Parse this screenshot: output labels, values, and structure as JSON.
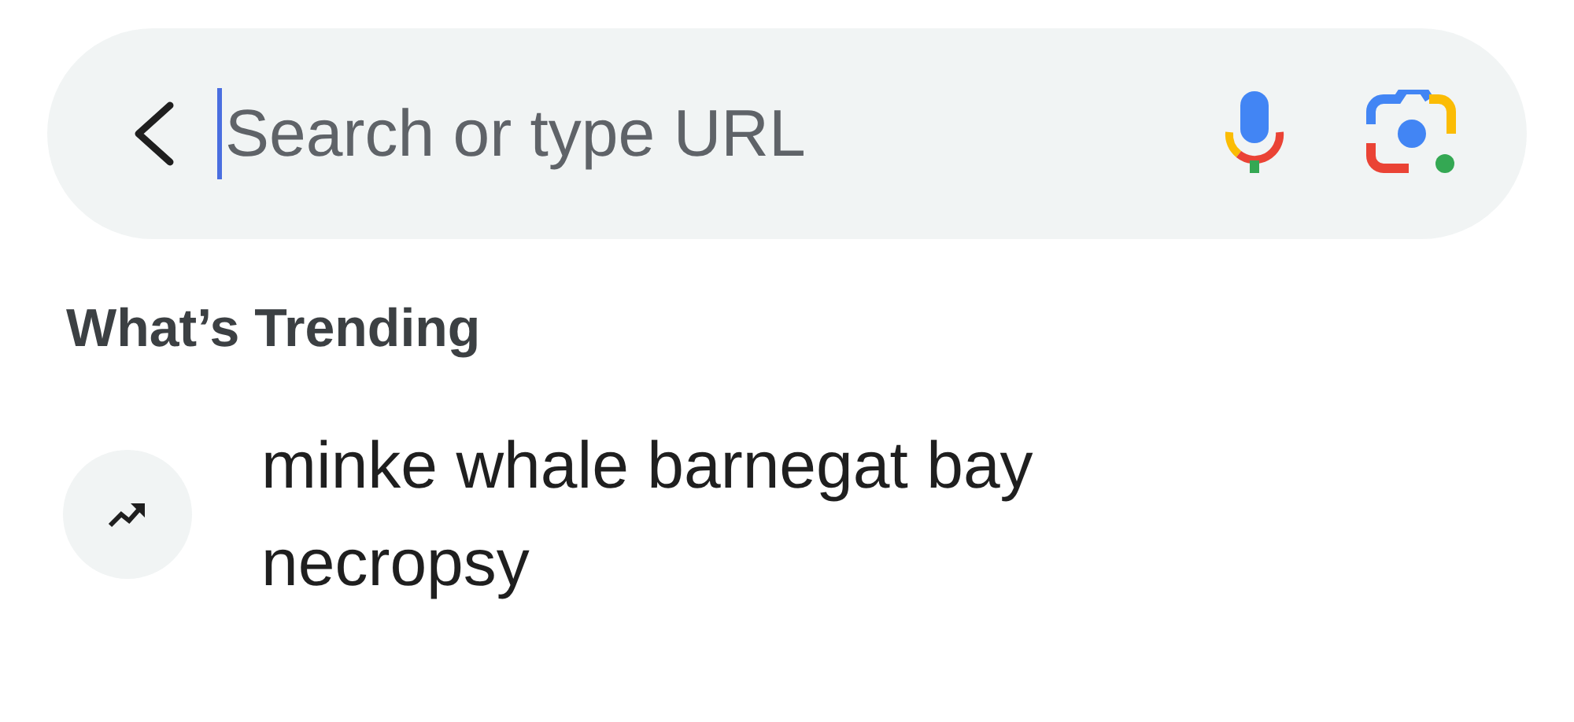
{
  "search": {
    "placeholder": "Search or type URL"
  },
  "section_title": "What’s Trending",
  "suggestions": [
    {
      "text": "minke whale barnegat bay necropsy"
    }
  ]
}
